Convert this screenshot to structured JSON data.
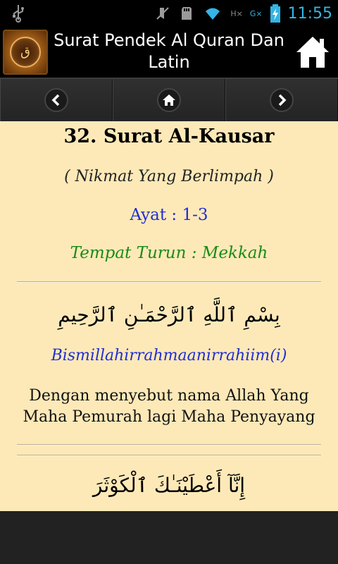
{
  "status_bar": {
    "network_label_1": "H×",
    "network_label_2": "G×",
    "time": "11:55"
  },
  "header": {
    "title": "Surat Pendek Al Quran Dan Latin",
    "logo_icon": "quran-logo",
    "home_icon": "home-icon"
  },
  "navbar": {
    "prev_icon": "chevron-left-icon",
    "home_icon": "home-icon",
    "next_icon": "chevron-right-icon"
  },
  "surah": {
    "title": "32. Surat Al-Kausar",
    "meaning": "( Nikmat Yang Berlimpah )",
    "ayat": "Ayat : 1-3",
    "tempat": "Tempat Turun : Mekkah"
  },
  "verses": [
    {
      "arabic": "بِسْمِ ٱللَّهِ ٱلرَّحْمَـٰنِ ٱلرَّحِيمِ",
      "latin": "Bismillahirrahmaanirrahiim(i)",
      "translation": "Dengan menyebut nama Allah Yang Maha Pemurah lagi Maha Penyayang"
    },
    {
      "arabic": "إِنَّآ أَعْطَيْنَـٰكَ ٱلْكَوْثَرَ"
    }
  ],
  "colors": {
    "content_bg": "#fde9b8",
    "latin_blue": "#1f2ed6",
    "tempat_green": "#1a8a16",
    "status_blue": "#33b5e5"
  }
}
